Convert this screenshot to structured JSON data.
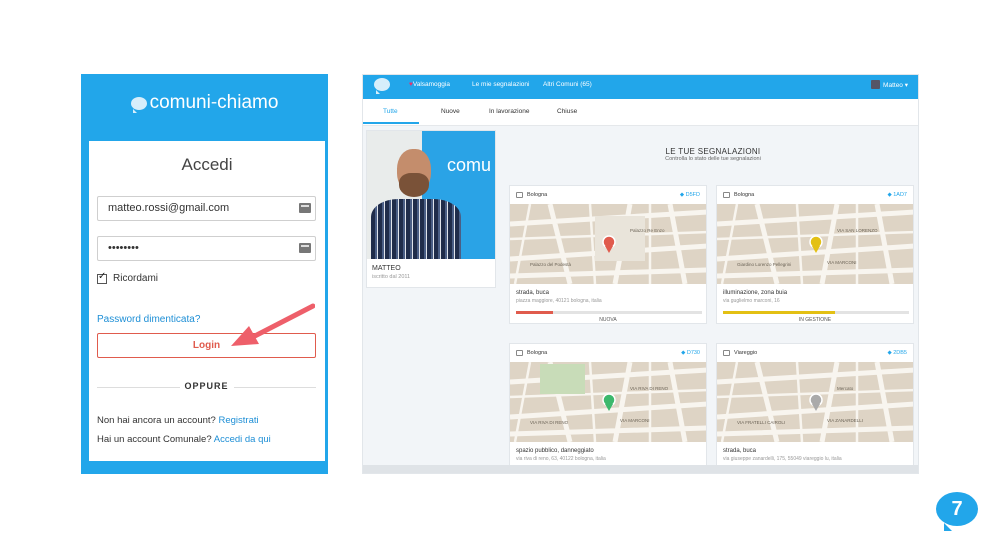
{
  "login": {
    "logo_part1": "comuni",
    "logo_sep": "-",
    "logo_part2": "chiamo",
    "title": "Accedi",
    "email_value": "matteo.rossi@gmail.com",
    "password_value": "••••••••",
    "remember_label": "Ricordami",
    "forgot_link": "Password dimenticata?",
    "login_button": "Login",
    "divider": "OPPURE",
    "no_account_text": "Non hai ancora un account?",
    "register_link": "Registrati",
    "municipal_text": "Hai un account Comunale?",
    "municipal_link": "Accedi da qui"
  },
  "dashboard": {
    "nav": {
      "valsamoggia": "Valsamoggia",
      "my_reports": "Le mie segnalazioni",
      "other_towns": "Altri Comuni (65)",
      "user": "Matteo ▾"
    },
    "tabs": [
      "Tutte",
      "Nuove",
      "In lavorazione",
      "Chiuse"
    ],
    "profile": {
      "photo_text": "comu",
      "name": "MATTEO",
      "since": "iscritto dal 2011"
    },
    "section_title": "LE TUE SEGNALAZIONI",
    "section_subtitle": "Controlla lo stato delle tue segnalazioni",
    "cards": [
      {
        "city": "Bologna",
        "code": "D5FD",
        "category": "strada, buca",
        "address": "piazza maggiore, 40121 bologna, italia",
        "status": "NUOVA",
        "progress": 0.2,
        "color": "#e05b4d",
        "street_labels": [
          "Palazzo Re Enzo",
          "Palazzo del Podestà"
        ]
      },
      {
        "city": "Bologna",
        "code": "1AD7",
        "category": "illuminazione, zona buia",
        "address": "via guglielmo marconi, 16",
        "status": "IN GESTIONE",
        "progress": 0.6,
        "color": "#e3c014",
        "street_labels": [
          "VIA SAN LORENZO",
          "Giardino Lorenzo Pellegrini",
          "VIA MARCONI"
        ]
      },
      {
        "city": "Bologna",
        "code": "D730",
        "category": "spazio pubblico, danneggiato",
        "address": "via riva di reno, 63, 40122 bologna, italia",
        "status": "",
        "progress": 0,
        "color": "#3cb86c",
        "street_labels": [
          "VIA RIVA DI RENO",
          "VIA RIVA DI RENO",
          "VIA MARCONI"
        ]
      },
      {
        "city": "Viareggio",
        "code": "2DB5",
        "category": "strada, buca",
        "address": "via giuseppe zanardelli, 175, 55049 viareggio lu, italia",
        "status": "",
        "progress": 0,
        "color": "#aaaaaa",
        "street_labels": [
          "Mercato",
          "VIA FRATELLI CAIROLI",
          "VIA ZANARDELLI"
        ]
      }
    ]
  },
  "badge": "7",
  "colors": {
    "primary": "#22a6ea",
    "danger": "#e05b4d",
    "warning": "#e3c014",
    "success": "#3cb86c"
  }
}
